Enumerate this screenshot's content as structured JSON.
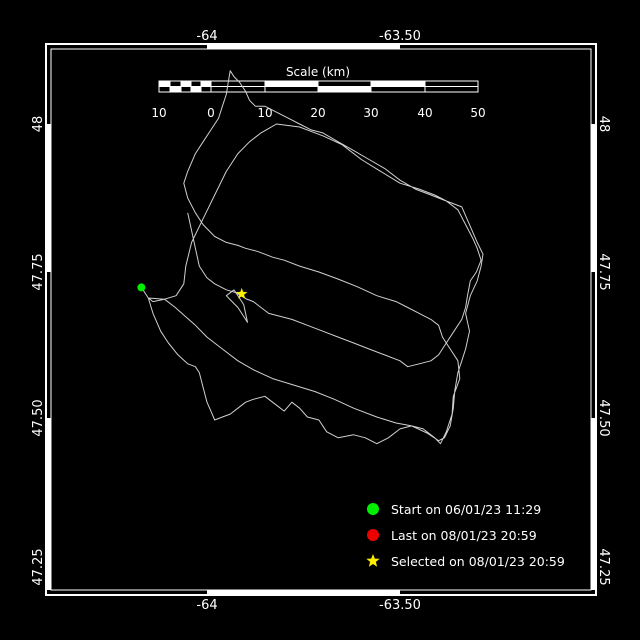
{
  "map": {
    "top_axis_labels": [
      "-64",
      "-63.50"
    ],
    "bottom_axis_labels": [
      "-64",
      "-63.50"
    ],
    "left_axis_labels": [
      "48",
      "47.75",
      "47.50",
      "47.25"
    ],
    "right_axis_labels": [
      "48",
      "47.75",
      "47.50",
      "47.25"
    ]
  },
  "scale_bar": {
    "title": "Scale (km)",
    "tick_labels": [
      "10",
      "0",
      "10",
      "20",
      "30",
      "40",
      "50"
    ]
  },
  "legend": {
    "start": {
      "label": "Start on 06/01/23 11:29",
      "color": "#00ee00"
    },
    "last": {
      "label": "Last on 08/01/23 20:59",
      "color": "#ee0000"
    },
    "selected": {
      "label": "Selected on 08/01/23 20:59",
      "color": "#ffee00"
    }
  },
  "colors": {
    "background": "#000000",
    "frame": "#ffffff",
    "track": "#d0d0d0"
  },
  "track": [
    [
      -64.17,
      47.724
    ],
    [
      -64.152,
      47.706
    ],
    [
      -64.11,
      47.704
    ],
    [
      -64.082,
      47.69
    ],
    [
      -64.058,
      47.676
    ],
    [
      -64.03,
      47.66
    ],
    [
      -64.0,
      47.64
    ],
    [
      -63.96,
      47.62
    ],
    [
      -63.92,
      47.6
    ],
    [
      -63.88,
      47.585
    ],
    [
      -63.83,
      47.57
    ],
    [
      -63.78,
      47.56
    ],
    [
      -63.72,
      47.548
    ],
    [
      -63.67,
      47.535
    ],
    [
      -63.62,
      47.52
    ],
    [
      -63.56,
      47.505
    ],
    [
      -63.51,
      47.495
    ],
    [
      -63.47,
      47.49
    ],
    [
      -63.43,
      47.478
    ],
    [
      -63.4,
      47.465
    ],
    [
      -63.385,
      47.47
    ],
    [
      -63.37,
      47.49
    ],
    [
      -63.362,
      47.52
    ],
    [
      -63.358,
      47.55
    ],
    [
      -63.35,
      47.58
    ],
    [
      -63.34,
      47.6
    ],
    [
      -63.33,
      47.62
    ],
    [
      -63.32,
      47.65
    ],
    [
      -63.33,
      47.68
    ],
    [
      -63.318,
      47.71
    ],
    [
      -63.3,
      47.735
    ],
    [
      -63.29,
      47.76
    ],
    [
      -63.285,
      47.78
    ],
    [
      -63.3,
      47.8
    ],
    [
      -63.32,
      47.83
    ],
    [
      -63.34,
      47.86
    ],
    [
      -63.38,
      47.87
    ],
    [
      -63.41,
      47.88
    ],
    [
      -63.45,
      47.89
    ],
    [
      -63.5,
      47.9
    ],
    [
      -63.55,
      47.92
    ],
    [
      -63.6,
      47.94
    ],
    [
      -63.65,
      47.965
    ],
    [
      -63.7,
      47.98
    ],
    [
      -63.76,
      47.995
    ],
    [
      -63.82,
      48.0
    ],
    [
      -63.86,
      47.985
    ],
    [
      -63.89,
      47.97
    ],
    [
      -63.92,
      47.95
    ],
    [
      -63.95,
      47.92
    ],
    [
      -63.98,
      47.88
    ],
    [
      -64.01,
      47.84
    ],
    [
      -64.04,
      47.8
    ],
    [
      -64.055,
      47.76
    ],
    [
      -64.06,
      47.73
    ],
    [
      -64.08,
      47.71
    ],
    [
      -64.11,
      47.704
    ],
    [
      -64.14,
      47.7
    ],
    [
      -64.152,
      47.706
    ],
    [
      -64.14,
      47.68
    ],
    [
      -64.12,
      47.65
    ],
    [
      -64.1,
      47.63
    ],
    [
      -64.075,
      47.61
    ],
    [
      -64.05,
      47.595
    ],
    [
      -64.03,
      47.59
    ],
    [
      -64.02,
      47.58
    ],
    [
      -64.01,
      47.555
    ],
    [
      -64.0,
      47.53
    ],
    [
      -63.99,
      47.515
    ],
    [
      -63.98,
      47.5
    ],
    [
      -63.96,
      47.505
    ],
    [
      -63.94,
      47.51
    ],
    [
      -63.92,
      47.52
    ],
    [
      -63.9,
      47.53
    ],
    [
      -63.88,
      47.535
    ],
    [
      -63.85,
      47.54
    ],
    [
      -63.82,
      47.525
    ],
    [
      -63.8,
      47.515
    ],
    [
      -63.78,
      47.53
    ],
    [
      -63.76,
      47.52
    ],
    [
      -63.74,
      47.505
    ],
    [
      -63.71,
      47.5
    ],
    [
      -63.69,
      47.48
    ],
    [
      -63.66,
      47.47
    ],
    [
      -63.62,
      47.475
    ],
    [
      -63.59,
      47.47
    ],
    [
      -63.56,
      47.46
    ],
    [
      -63.53,
      47.47
    ],
    [
      -63.5,
      47.485
    ],
    [
      -63.47,
      47.49
    ],
    [
      -63.44,
      47.485
    ],
    [
      -63.41,
      47.47
    ],
    [
      -63.395,
      47.46
    ],
    [
      -63.38,
      47.48
    ],
    [
      -63.365,
      47.51
    ],
    [
      -63.362,
      47.54
    ],
    [
      -63.345,
      47.57
    ],
    [
      -63.35,
      47.6
    ],
    [
      -63.37,
      47.62
    ],
    [
      -63.39,
      47.64
    ],
    [
      -63.4,
      47.66
    ],
    [
      -63.42,
      47.67
    ],
    [
      -63.45,
      47.68
    ],
    [
      -63.48,
      47.69
    ],
    [
      -63.51,
      47.7
    ],
    [
      -63.56,
      47.71
    ],
    [
      -63.61,
      47.725
    ],
    [
      -63.66,
      47.738
    ],
    [
      -63.71,
      47.75
    ],
    [
      -63.76,
      47.76
    ],
    [
      -63.8,
      47.77
    ],
    [
      -63.83,
      47.775
    ],
    [
      -63.85,
      47.78
    ],
    [
      -63.87,
      47.785
    ],
    [
      -63.9,
      47.79
    ],
    [
      -63.92,
      47.795
    ],
    [
      -63.95,
      47.8
    ],
    [
      -63.98,
      47.81
    ],
    [
      -64.01,
      47.83
    ],
    [
      -64.03,
      47.85
    ],
    [
      -64.05,
      47.875
    ],
    [
      -64.06,
      47.9
    ],
    [
      -64.05,
      47.92
    ],
    [
      -64.03,
      47.95
    ],
    [
      -64.01,
      47.97
    ],
    [
      -63.99,
      47.99
    ],
    [
      -63.97,
      48.01
    ],
    [
      -63.96,
      48.03
    ],
    [
      -63.95,
      48.05
    ],
    [
      -63.945,
      48.07
    ],
    [
      -63.94,
      48.09
    ],
    [
      -63.93,
      48.08
    ],
    [
      -63.915,
      48.07
    ],
    [
      -63.9,
      48.055
    ],
    [
      -63.89,
      48.04
    ],
    [
      -63.875,
      48.03
    ],
    [
      -63.85,
      48.03
    ],
    [
      -63.82,
      48.02
    ],
    [
      -63.79,
      48.01
    ],
    [
      -63.76,
      48.0
    ],
    [
      -63.73,
      47.99
    ],
    [
      -63.7,
      47.985
    ],
    [
      -63.66,
      47.97
    ],
    [
      -63.62,
      47.955
    ],
    [
      -63.58,
      47.94
    ],
    [
      -63.54,
      47.925
    ],
    [
      -63.5,
      47.905
    ],
    [
      -63.46,
      47.89
    ],
    [
      -63.42,
      47.88
    ],
    [
      -63.38,
      47.87
    ],
    [
      -63.35,
      47.855
    ],
    [
      -63.33,
      47.83
    ],
    [
      -63.31,
      47.805
    ],
    [
      -63.3,
      47.79
    ],
    [
      -63.29,
      47.77
    ],
    [
      -63.302,
      47.75
    ],
    [
      -63.318,
      47.735
    ],
    [
      -63.325,
      47.71
    ],
    [
      -63.33,
      47.69
    ],
    [
      -63.34,
      47.67
    ],
    [
      -63.36,
      47.65
    ],
    [
      -63.38,
      47.63
    ],
    [
      -63.4,
      47.61
    ],
    [
      -63.42,
      47.6
    ],
    [
      -63.45,
      47.595
    ],
    [
      -63.48,
      47.59
    ],
    [
      -63.5,
      47.6
    ],
    [
      -63.54,
      47.61
    ],
    [
      -63.58,
      47.62
    ],
    [
      -63.62,
      47.63
    ],
    [
      -63.66,
      47.64
    ],
    [
      -63.7,
      47.65
    ],
    [
      -63.74,
      47.66
    ],
    [
      -63.78,
      47.67
    ],
    [
      -63.81,
      47.675
    ],
    [
      -63.84,
      47.68
    ],
    [
      -63.86,
      47.69
    ],
    [
      -63.88,
      47.7
    ],
    [
      -63.9,
      47.705
    ],
    [
      -63.925,
      47.715
    ],
    [
      -63.95,
      47.72
    ],
    [
      -63.98,
      47.73
    ],
    [
      -64.0,
      47.74
    ],
    [
      -64.02,
      47.76
    ],
    [
      -64.03,
      47.79
    ],
    [
      -64.04,
      47.82
    ],
    [
      -64.05,
      47.85
    ]
  ],
  "inner_loop": [
    [
      -63.93,
      47.72
    ],
    [
      -63.915,
      47.705
    ],
    [
      -63.905,
      47.695
    ],
    [
      -63.9,
      47.68
    ],
    [
      -63.895,
      47.665
    ],
    [
      -63.905,
      47.675
    ],
    [
      -63.92,
      47.69
    ],
    [
      -63.935,
      47.7
    ],
    [
      -63.95,
      47.71
    ],
    [
      -63.93,
      47.72
    ]
  ],
  "points": {
    "start": [
      -64.17,
      47.724
    ],
    "selected": [
      -63.91,
      47.713
    ]
  }
}
